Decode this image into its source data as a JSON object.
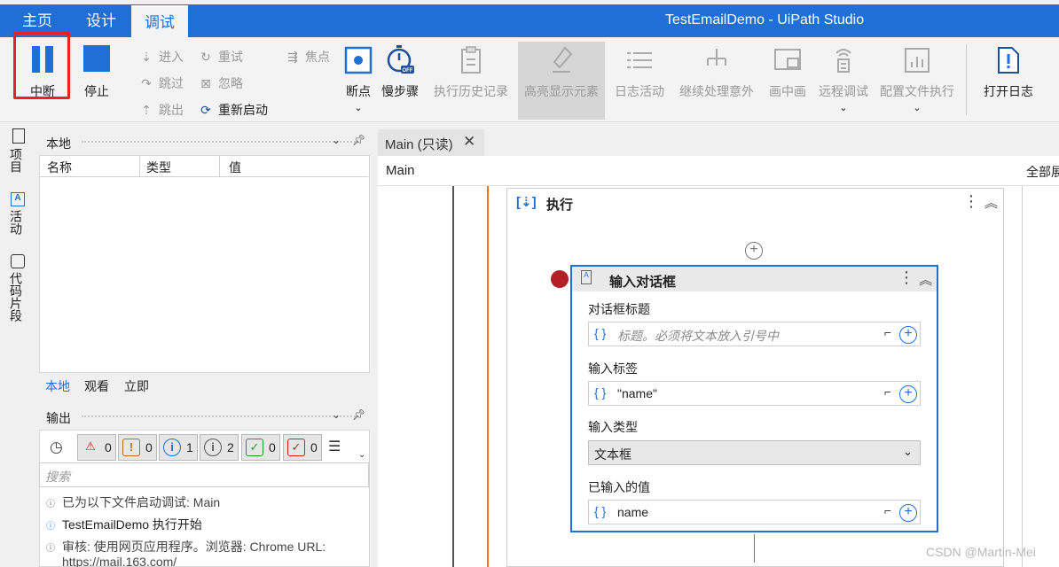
{
  "titlebar": {
    "tabs": [
      "主页",
      "设计",
      "调试"
    ],
    "active_tab": "调试",
    "title": "TestEmailDemo - UiPath Studio"
  },
  "ribbon": {
    "pause": "中断",
    "stop": "停止",
    "step_into": "进入",
    "step_over": "跳过",
    "step_out": "跳出",
    "retry": "重试",
    "ignore": "忽略",
    "restart": "重新启动",
    "focus": "焦点",
    "breakpoints": "断点",
    "slow_step": "慢步骤",
    "execution_trail": "执行历史记录",
    "highlight_elements": "高亮显示元素",
    "log_activities": "日志活动",
    "continue_on_exception": "继续处理意外",
    "picture_in_picture": "画中画",
    "remote_debugging": "远程调试",
    "profile_execution": "配置文件执行",
    "open_logs": "打开日志",
    "slow_badge": "OFF"
  },
  "rail": {
    "project": "项目",
    "activities": "活动",
    "snippets": "代码片段"
  },
  "locals_panel": {
    "title": "本地",
    "columns": [
      "名称",
      "类型",
      "值"
    ],
    "tabs": [
      "本地",
      "观看",
      "立即"
    ]
  },
  "output_panel": {
    "title": "输出",
    "counts": {
      "error": "0",
      "warning": "0",
      "info": "1",
      "trace": "2",
      "success": "0",
      "failure": "0"
    },
    "search_placeholder": "搜索",
    "logs": [
      "已为以下文件启动调试: Main",
      "TestEmailDemo 执行开始",
      "审核: 使用网页应用程序。浏览器: Chrome URL:",
      "https://mail.163.com/"
    ]
  },
  "designer": {
    "doc_tab": "Main (只读)",
    "breadcrumb": "Main",
    "expand_all": "全部展开",
    "sequence_title": "执行",
    "activity_title": "输入对话框",
    "fields": {
      "dialog_title_label": "对话框标题",
      "dialog_title_placeholder": "标题。必须将文本放入引号中",
      "input_label_label": "输入标签",
      "input_label_value": "\"name\"",
      "input_type_label": "输入类型",
      "input_type_value": "文本框",
      "value_entered_label": "已输入的值",
      "value_entered_value": "name"
    }
  },
  "watermark": "CSDN @Martin-Mei"
}
